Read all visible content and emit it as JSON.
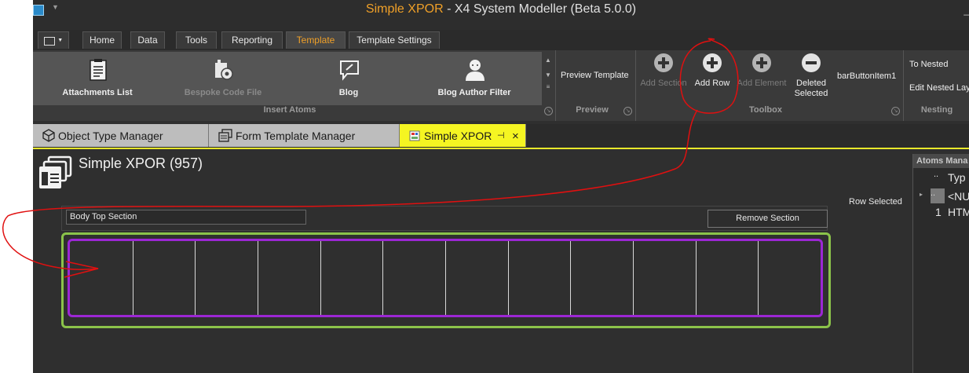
{
  "window": {
    "title_accent": "Simple XPOR",
    "title_rest": "- X4 System Modeller (Beta 5.0.0)",
    "minimize_glyph": "_"
  },
  "ribbon_tabs": [
    {
      "label": "Home"
    },
    {
      "label": "Data"
    },
    {
      "label": "Tools"
    },
    {
      "label": "Reporting"
    },
    {
      "label": "Template",
      "active": true
    },
    {
      "label": "Template Settings"
    }
  ],
  "insert_atoms": {
    "group_label": "Insert Atoms",
    "items": [
      {
        "label": "Attachments List",
        "icon": "list-document-icon"
      },
      {
        "label": "Bespoke Code File",
        "icon": "code-file-icon",
        "disabled": true
      },
      {
        "label": "Blog",
        "icon": "blog-icon"
      },
      {
        "label": "Blog Author Filter",
        "icon": "user-icon"
      }
    ]
  },
  "preview": {
    "group_label": "Preview",
    "button_label": "Preview Template"
  },
  "toolbox": {
    "group_label": "Toolbox",
    "add_section": "Add Section",
    "add_row": "Add Row",
    "add_element": "Add Element",
    "deleted_selected_1": "Deleted",
    "deleted_selected_2": "Selected",
    "bar_button": "barButtonItem1"
  },
  "nesting": {
    "group_label": "Nesting",
    "to_nested": "To Nested",
    "edit_nested": "Edit Nested Lay"
  },
  "doc_tabs": [
    {
      "label": "Object Type Manager"
    },
    {
      "label": "Form Template Manager"
    },
    {
      "label": "Simple XPOR",
      "active": true
    }
  ],
  "doc_tab_pin": "⊣",
  "doc_tab_close": "×",
  "page": {
    "title": "Simple XPOR (957)",
    "row_selected": "Row Selected",
    "section_name": "Body Top Section",
    "remove_section": "Remove Section",
    "cell_count": 12
  },
  "atoms_panel": {
    "header": "Atoms Mana",
    "col_dots": "..",
    "col_type": "Typ",
    "rows": [
      {
        "dots": "..",
        "value": "<NU"
      },
      {
        "index": "1",
        "value": "HTM"
      }
    ]
  },
  "colors": {
    "accent": "#f0a028",
    "section_outline": "#8bc34a",
    "row_outline": "#9c27d4",
    "active_doc_tab": "#f5f522",
    "annotation": "#e01010"
  }
}
